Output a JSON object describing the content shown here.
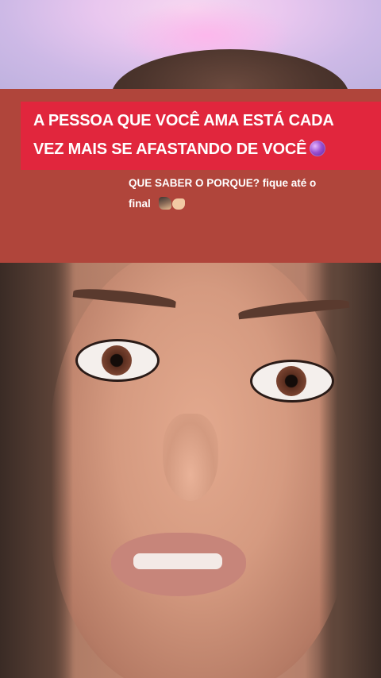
{
  "video_overlay": {
    "headline_line1": "A PESSOA QUE VOCÊ AMA ESTÁ CADA",
    "headline_line2": "VEZ MAIS SE AFASTANDO DE VOCÊ",
    "subtitle_line1": "QUE SABER O PORQUE? fique até o",
    "subtitle_line2": "final"
  },
  "icons": {
    "headline_end": "crystal-ball-icon",
    "subtitle_end": [
      "shaking-hands-emoji-icon",
      "pointing-hand-emoji-icon"
    ]
  },
  "colors": {
    "overlay_bg": "#b0453b",
    "headline_bg": "#e1263d",
    "text": "#ffffff"
  }
}
